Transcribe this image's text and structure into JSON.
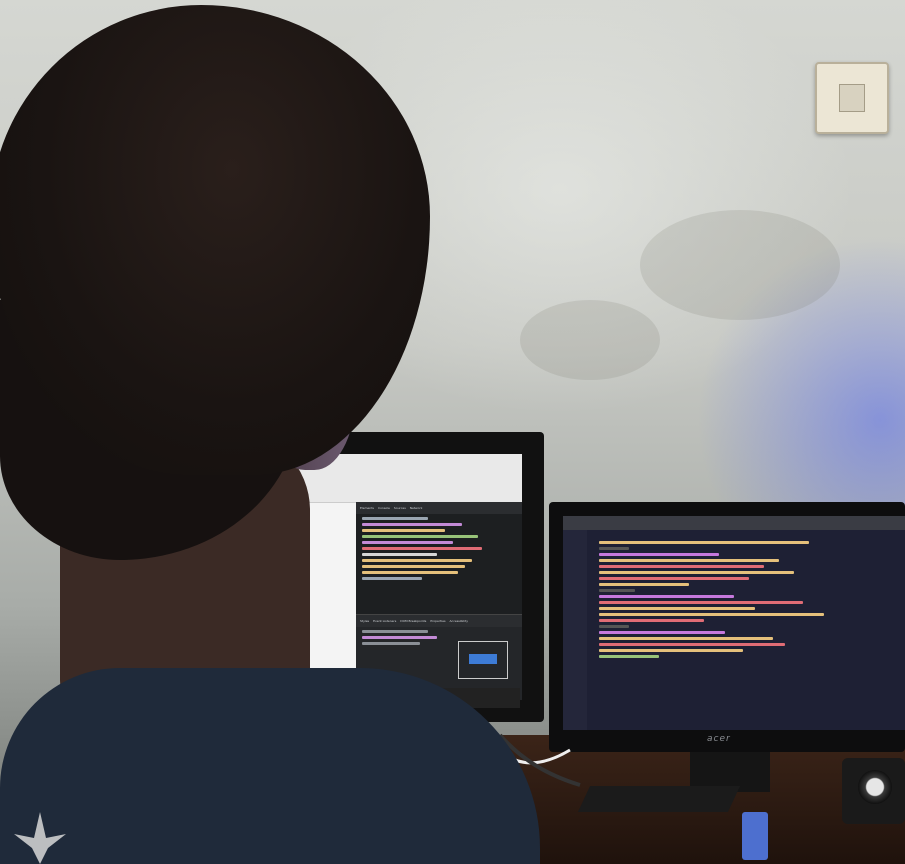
{
  "scene": {
    "description_tags": [
      "wall-light-switch",
      "left-monitor",
      "right-monitor",
      "person",
      "desk",
      "speaker",
      "usb-drive"
    ]
  },
  "left_monitor": {
    "devtools_tabs": [
      "Elements",
      "Console",
      "Sources",
      "Network"
    ],
    "styles_tabs": [
      "Styles",
      "Event Listeners",
      "DOM Breakpoints",
      "Properties",
      "Accessibility"
    ]
  },
  "right_monitor": {
    "brand": "acer"
  },
  "colors": {
    "wall": "#c6c8c3",
    "shirt": "#1f2a3a",
    "code_bg": "#1e2034",
    "devtools_bg": "#1d1f21",
    "led_glow": "#5a6ef0"
  }
}
